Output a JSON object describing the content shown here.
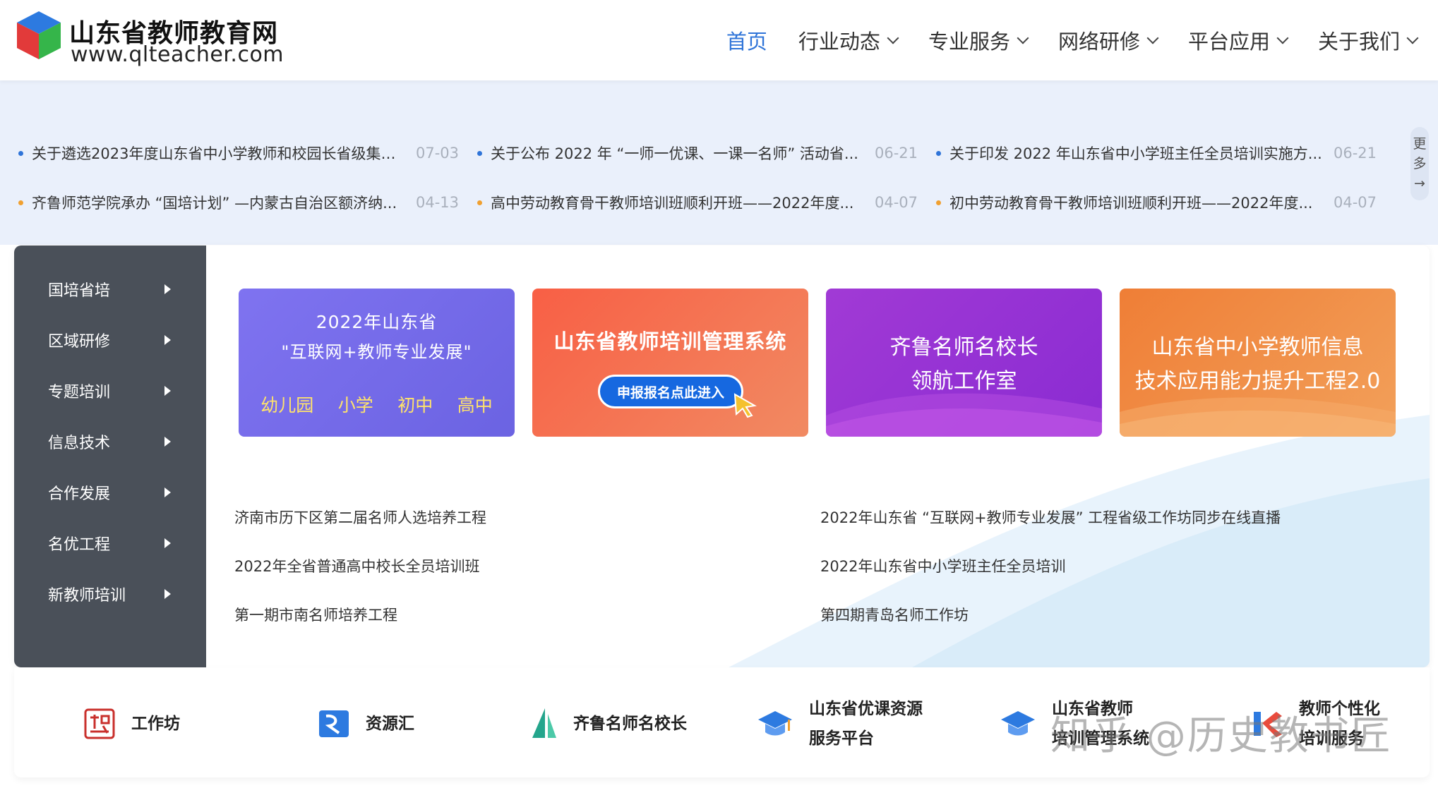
{
  "header": {
    "logo_title": "山东省教师教育网",
    "logo_url": "www.qlteacher.com",
    "nav": [
      {
        "label": "首页",
        "active": true
      },
      {
        "label": "行业动态"
      },
      {
        "label": "专业服务"
      },
      {
        "label": "网络研修"
      },
      {
        "label": "平台应用"
      },
      {
        "label": "关于我们"
      }
    ]
  },
  "news": {
    "more": [
      "更",
      "多",
      "→"
    ],
    "rows": [
      [
        {
          "title": "关于遴选2023年度山东省中小学教师和校园长省级集中...",
          "date": "07-03"
        },
        {
          "title": "关于公布 2022 年 “一师一优课、一课一名师” 活动省...",
          "date": "06-21"
        },
        {
          "title": "关于印发 2022 年山东省中小学班主任全员培训实施方...",
          "date": "06-21"
        }
      ],
      [
        {
          "title": "齐鲁师范学院承办 “国培计划” —内蒙古自治区额济纳...",
          "date": "04-13"
        },
        {
          "title": "高中劳动教育骨干教师培训班顺利开班——2022年度...",
          "date": "04-07"
        },
        {
          "title": "初中劳动教育骨干教师培训班顺利开班——2022年度...",
          "date": "04-07"
        }
      ]
    ],
    "dot_colors": [
      "#2f74d8",
      "#f0a030"
    ]
  },
  "sidebar": {
    "items": [
      "国培省培",
      "区域研修",
      "专题培训",
      "信息技术",
      "合作发展",
      "名优工程",
      "新教师培训"
    ]
  },
  "banners": {
    "b1": {
      "line1": "2022年山东省",
      "line2": "\"互联网+教师专业发展\"",
      "levels": [
        "幼儿园",
        "小学",
        "初中",
        "高中"
      ]
    },
    "b2": {
      "title": "山东省教师培训管理系统",
      "button": "申报报名点此进入"
    },
    "b3": {
      "line1": "齐鲁名师名校长",
      "line2": "领航工作室"
    },
    "b4": {
      "line1": "山东省中小学教师信息",
      "line2": "技术应用能力提升工程2.0"
    }
  },
  "links": [
    [
      "济南市历下区第二届名师人选培养工程",
      "2022年山东省 “互联网+教师专业发展” 工程省级工作坊同步在线直播"
    ],
    [
      "2022年全省普通高中校长全员培训班",
      "2022年山东省中小学班主任全员培训"
    ],
    [
      "第一期市南名师培养工程",
      "第四期青岛名师工作坊"
    ]
  ],
  "platforms": [
    {
      "label": "工作坊",
      "icon": "workshop-seal-icon"
    },
    {
      "label": "资源汇",
      "icon": "resource-hub-icon"
    },
    {
      "label": "齐鲁名师名校长",
      "icon": "sail-icon"
    },
    {
      "label1": "山东省优课资源",
      "label2": "服务平台",
      "icon": "graduation-cap-icon"
    },
    {
      "label1": "山东省教师",
      "label2": "培训管理系统",
      "icon": "graduation-cap-icon"
    },
    {
      "label1": "教师个性化",
      "label2": "培训服务",
      "icon": "k-logo-icon"
    }
  ],
  "watermark": "知乎 @历史教书匠",
  "colors": {
    "accent": "#2f74d8",
    "sidebar": "#4a5059",
    "band": "#eaf0fb"
  }
}
